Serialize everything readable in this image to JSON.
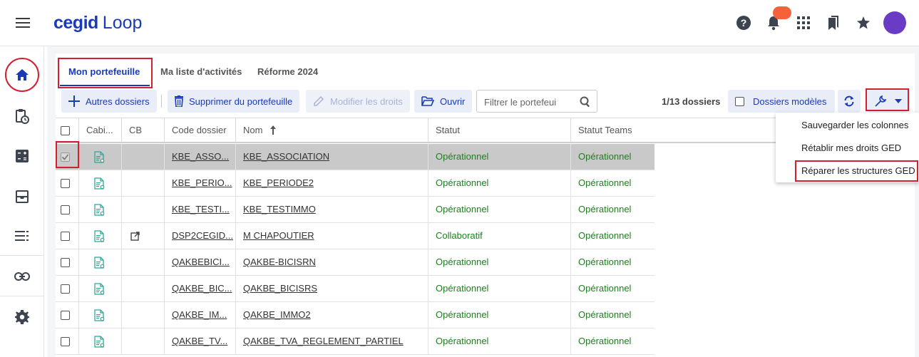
{
  "app": {
    "brand": "cegid",
    "product": "Loop"
  },
  "topbar": {
    "icons": [
      "help-icon",
      "bell-icon",
      "apps-grid-icon",
      "bookmarks-icon",
      "star-icon"
    ]
  },
  "leftnav": {
    "items": [
      "home-icon",
      "clipboard-clock-icon",
      "calculator-icon",
      "inbox-icon",
      "list-icon",
      "link-icon",
      "gear-icon"
    ]
  },
  "tabs": [
    {
      "label": "Mon portefeuille",
      "active": true
    },
    {
      "label": "Ma liste d'activités",
      "active": false
    },
    {
      "label": "Réforme 2024",
      "active": false
    }
  ],
  "toolbar": {
    "other_files": "Autres dossiers",
    "remove": "Supprimer du portefeuille",
    "edit_rights": "Modifier les droits",
    "open": "Ouvrir",
    "filter_placeholder": "Filtrer le portefeui",
    "count": "1/13 dossiers",
    "models": "Dossiers modèles"
  },
  "table": {
    "headers": [
      "Cabi...",
      "CB",
      "Code dossier",
      "Nom",
      "Statut",
      "Statut Teams"
    ],
    "rows": [
      {
        "code": "KBE_ASSO...",
        "nom": "KBE_ASSOCIATION",
        "statut": "Opérationnel",
        "teams": "Opérationnel",
        "selected": true,
        "cb": false
      },
      {
        "code": "KBE_PERIO...",
        "nom": "KBE_PERIODE2",
        "statut": "Opérationnel",
        "teams": "Opérationnel",
        "selected": false,
        "cb": false
      },
      {
        "code": "KBE_TESTI...",
        "nom": "KBE_TESTIMMO",
        "statut": "Opérationnel",
        "teams": "Opérationnel",
        "selected": false,
        "cb": false
      },
      {
        "code": "DSP2CEGID...",
        "nom": "M CHAPOUTIER",
        "statut": "Collaboratif",
        "teams": "Opérationnel",
        "selected": false,
        "cb": true
      },
      {
        "code": "QAKBEBICI...",
        "nom": "QAKBE-BICISRN",
        "statut": "Opérationnel",
        "teams": "Opérationnel",
        "selected": false,
        "cb": false
      },
      {
        "code": "QAKBE_BIC...",
        "nom": "QAKBE_BICISRS",
        "statut": "Opérationnel",
        "teams": "Opérationnel",
        "selected": false,
        "cb": false
      },
      {
        "code": "QAKBE_IM...",
        "nom": "QAKBE_IMMO2",
        "statut": "Opérationnel",
        "teams": "Opérationnel",
        "selected": false,
        "cb": false
      },
      {
        "code": "QAKBE_TV...",
        "nom": "QAKBE_TVA_REGLEMENT_PARTIEL",
        "statut": "Opérationnel",
        "teams": "Opérationnel",
        "selected": false,
        "cb": false
      }
    ]
  },
  "menu": {
    "items": [
      "Sauvegarder les colonnes",
      "Rétablir mes droits GED",
      "Réparer les structures GED"
    ]
  },
  "colors": {
    "accent": "#1a3bb8",
    "status_green": "#1e7f1e",
    "highlight_red": "#d32030",
    "avatar": "#6a3bc4",
    "badge": "#f5623a"
  }
}
